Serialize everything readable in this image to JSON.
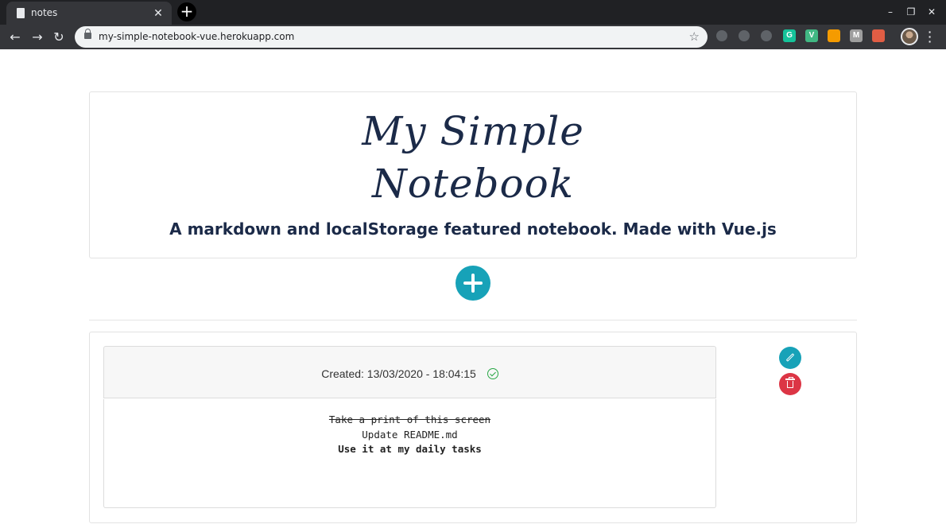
{
  "browser": {
    "tab_title": "notes",
    "tab_close": "✕",
    "new_tab": "+",
    "url": "my-simple-notebook-vue.herokuapp.com",
    "window_controls": {
      "minimize": "–",
      "maximize": "❐",
      "close": "✕"
    },
    "extensions": [
      {
        "name": "pocket-icon",
        "color": "#5f6368",
        "glyph": ""
      },
      {
        "name": "chat-extension-icon",
        "color": "#5f6368",
        "glyph": ""
      },
      {
        "name": "react-devtools-icon",
        "color": "#5f6368",
        "glyph": ""
      },
      {
        "name": "grammarly-icon",
        "color": "#15c39a",
        "glyph": "G"
      },
      {
        "name": "vue-devtools-icon",
        "color": "#41b883",
        "glyph": "V"
      },
      {
        "name": "orange-extension-icon",
        "color": "#f59b00",
        "glyph": ""
      },
      {
        "name": "m-extension-icon",
        "color": "#9e9e9e",
        "glyph": "M"
      },
      {
        "name": "colorful-extension-icon",
        "color": "#e05d44",
        "glyph": ""
      }
    ]
  },
  "header": {
    "title_line1": "My Simple",
    "title_line2": "Notebook",
    "subtitle": "A markdown and localStorage featured notebook. Made with Vue.js"
  },
  "notes": [
    {
      "created": "Created: 13/03/2020 - 18:04:15",
      "status_icon": "check-circle-icon",
      "lines": [
        {
          "text": "Take a print of this screen",
          "style": "done"
        },
        {
          "text": "Update README.md",
          "style": "normal"
        },
        {
          "text": "Use it at my daily tasks",
          "style": "bold"
        }
      ]
    }
  ],
  "colors": {
    "accent": "#17a2b8",
    "danger": "#dc3545",
    "success": "#28a745",
    "title": "#1b2a48"
  }
}
